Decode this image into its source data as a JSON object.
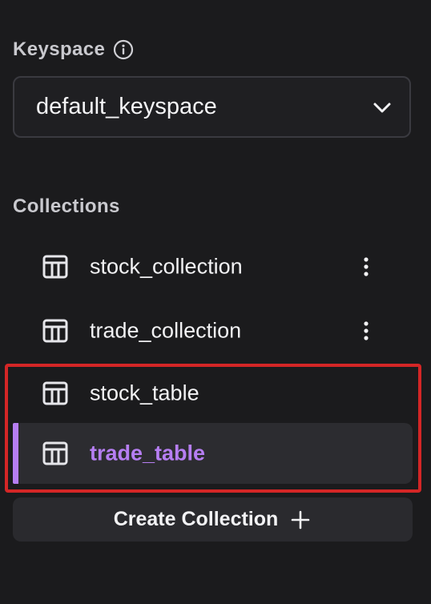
{
  "keyspace": {
    "label": "Keyspace",
    "info_icon": "info-icon",
    "selected": "default_keyspace",
    "dropdown_icon": "chevron-down-icon"
  },
  "collections": {
    "label": "Collections",
    "items": [
      {
        "name": "stock_collection",
        "icon": "table-icon",
        "has_menu": true,
        "active": false
      },
      {
        "name": "trade_collection",
        "icon": "table-icon",
        "has_menu": true,
        "active": false
      },
      {
        "name": "stock_table",
        "icon": "table-icon",
        "has_menu": false,
        "active": false
      },
      {
        "name": "trade_table",
        "icon": "table-icon",
        "has_menu": false,
        "active": true
      }
    ]
  },
  "create_button": {
    "label": "Create Collection",
    "icon": "plus-icon"
  },
  "colors": {
    "background": "#1b1b1d",
    "accent": "#b67ef2",
    "highlight": "#d42626"
  }
}
